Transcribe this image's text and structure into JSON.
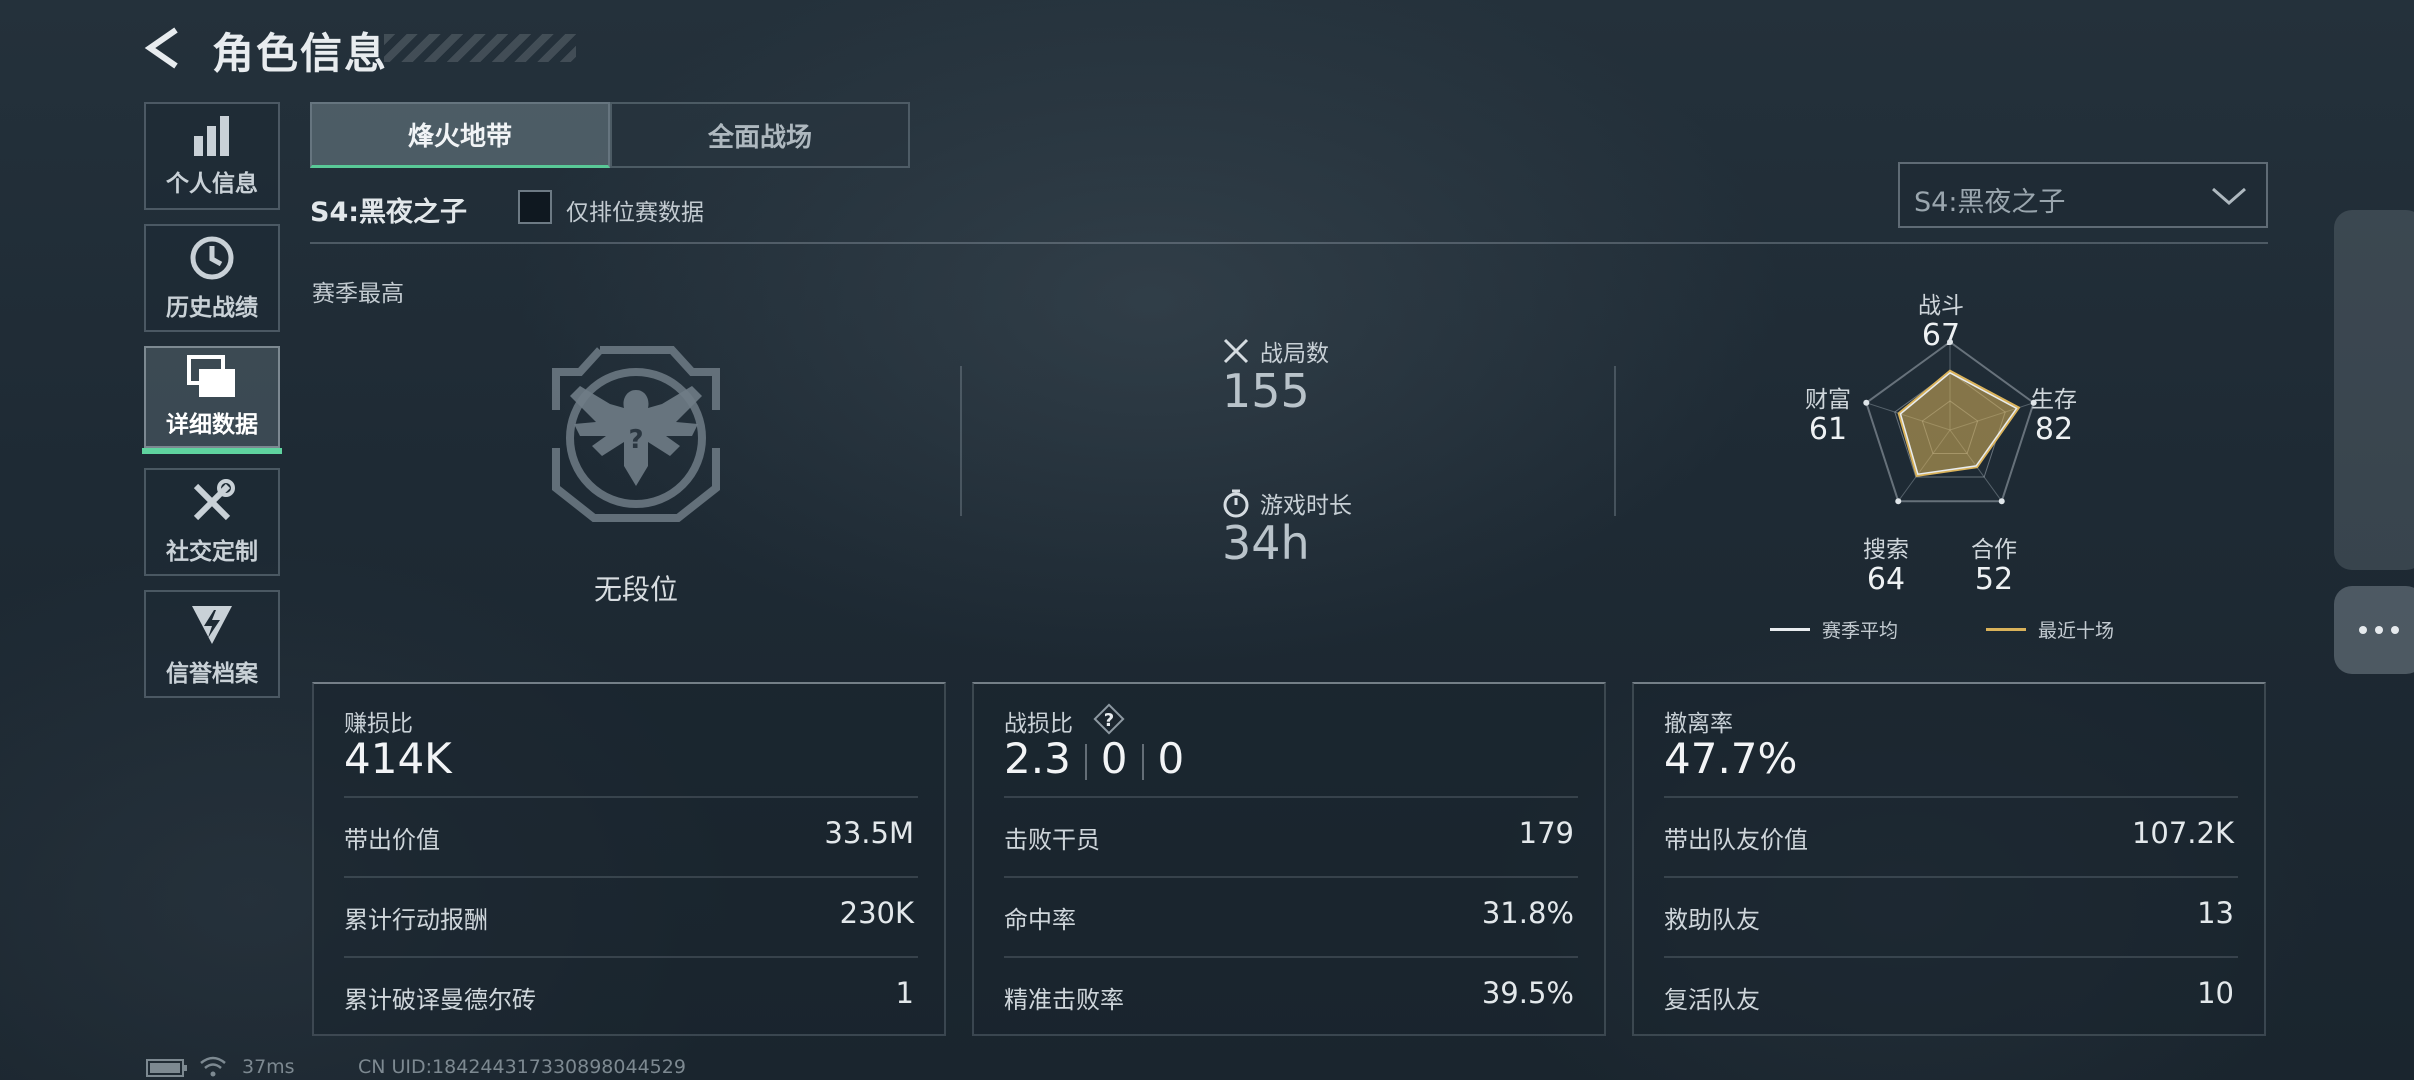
{
  "header": {
    "title": "角色信息"
  },
  "sidebar": {
    "items": [
      {
        "label": "个人信息",
        "icon": "bar-chart-icon"
      },
      {
        "label": "历史战绩",
        "icon": "history-icon"
      },
      {
        "label": "详细数据",
        "icon": "cards-icon",
        "active": true
      },
      {
        "label": "社交定制",
        "icon": "tools-icon"
      },
      {
        "label": "信誉档案",
        "icon": "badge-icon"
      }
    ]
  },
  "tabs": [
    {
      "label": "烽火地带",
      "active": true
    },
    {
      "label": "全面战场",
      "active": false
    }
  ],
  "season": {
    "name": "S4:黑夜之子",
    "ranked_only_label": "仅排位赛数据",
    "ranked_only_checked": false,
    "dropdown_value": "S4:黑夜之子",
    "best_label": "赛季最高"
  },
  "rank": {
    "label": "无段位"
  },
  "overview": {
    "matches_label": "战局数",
    "matches_value": "155",
    "playtime_label": "游戏时长",
    "playtime_value": "34h"
  },
  "radar": {
    "axes": [
      {
        "label": "战斗",
        "value": "67"
      },
      {
        "label": "生存",
        "value": "82"
      },
      {
        "label": "合作",
        "value": "52"
      },
      {
        "label": "搜索",
        "value": "64"
      },
      {
        "label": "财富",
        "value": "61"
      }
    ],
    "legend": [
      {
        "label": "赛季平均",
        "color": "#e8ecef"
      },
      {
        "label": "最近十场",
        "color": "#d9b25a"
      }
    ]
  },
  "cards": [
    {
      "title": "赚损比",
      "value": "414K",
      "rows": [
        {
          "label": "带出价值",
          "value": "33.5M"
        },
        {
          "label": "累计行动报酬",
          "value": "230K"
        },
        {
          "label": "累计破译曼德尔砖",
          "value": "1"
        }
      ]
    },
    {
      "title": "战损比",
      "value_parts": [
        "2.3",
        "0",
        "0"
      ],
      "rows": [
        {
          "label": "击败干员",
          "value": "179"
        },
        {
          "label": "命中率",
          "value": "31.8%"
        },
        {
          "label": "精准击败率",
          "value": "39.5%"
        }
      ]
    },
    {
      "title": "撤离率",
      "value": "47.7%",
      "rows": [
        {
          "label": "带出队友价值",
          "value": "107.2K"
        },
        {
          "label": "救助队友",
          "value": "13"
        },
        {
          "label": "复活队友",
          "value": "10"
        }
      ]
    }
  ],
  "status": {
    "ping": "37ms",
    "uid": "CN UID:18424431733089804452​9"
  },
  "colors": {
    "accent": "#5fd39f",
    "radar_recent": "#d9b25a"
  }
}
